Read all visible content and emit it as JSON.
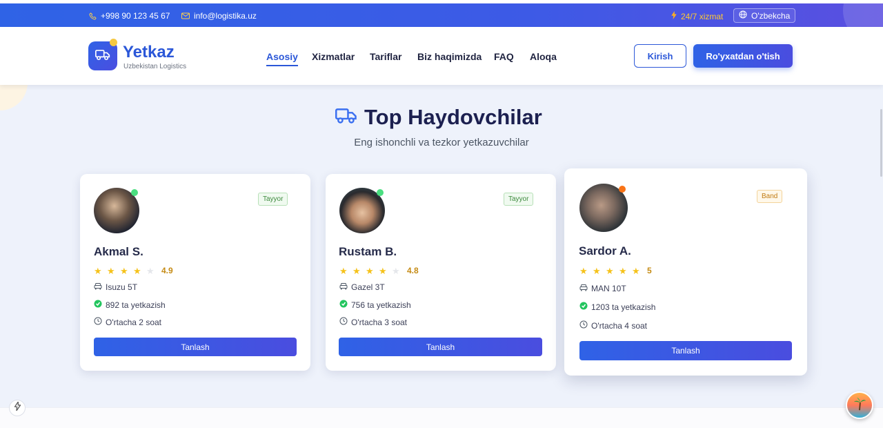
{
  "topbar": {
    "phone": "+998 90 123 45 67",
    "email": "info@logistika.uz",
    "service": "24/7 xizmat",
    "language": "O'zbekcha"
  },
  "header": {
    "brand": "Yetkaz",
    "brand_sub": "Uzbekistan Logistics",
    "nav": [
      "Asosiy",
      "Xizmatlar",
      "Tariflar",
      "Biz haqimizda",
      "FAQ",
      "Aloqa"
    ],
    "active_nav": "Asosiy",
    "login_label": "Kirish",
    "register_label": "Ro'yxatdan o'tish"
  },
  "section": {
    "title": "Top Haydovchilar",
    "subtitle": "Eng ishonchli va tezkor yetkazuvchilar"
  },
  "drivers": [
    {
      "name": "Akmal S.",
      "status": "Tayyor",
      "status_color": "#4ade80",
      "rating": "4.9",
      "stars": 4,
      "vehicle": "Isuzu 5T",
      "deliveries": "892 ta yetkazish",
      "avg_time": "O'rtacha 2 soat",
      "button": "Tanlash"
    },
    {
      "name": "Rustam B.",
      "status": "Tayyor",
      "status_color": "#4ade80",
      "rating": "4.8",
      "stars": 4,
      "vehicle": "Gazel 3T",
      "deliveries": "756 ta yetkazish",
      "avg_time": "O'rtacha 3 soat",
      "button": "Tanlash"
    },
    {
      "name": "Sardor A.",
      "status": "Band",
      "status_color": "#f97316",
      "rating": "5",
      "stars": 5,
      "vehicle": "MAN 10T",
      "deliveries": "1203 ta yetkazish",
      "avg_time": "O'rtacha 4 soat",
      "button": "Tanlash"
    }
  ],
  "colors": {
    "primary": "#2b57d8",
    "accent_gold": "#f5c21b",
    "success": "#22c55e"
  }
}
